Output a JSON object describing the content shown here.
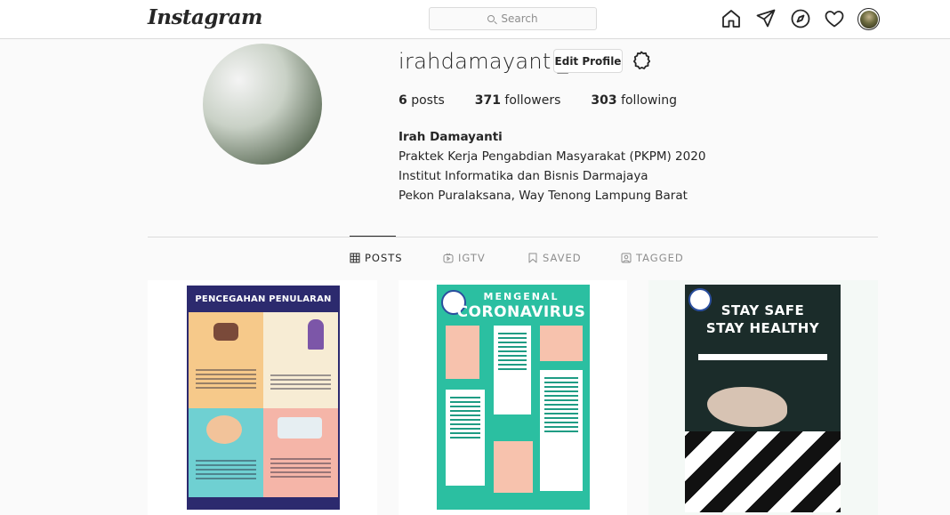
{
  "nav": {
    "logo": "Instagram",
    "search_placeholder": "Search",
    "icons": [
      "home-icon",
      "direct-icon",
      "explore-icon",
      "activity-heart-icon",
      "profile-avatar"
    ]
  },
  "profile": {
    "username": "irahdamayanti_",
    "edit_button": "Edit Profile",
    "stats": {
      "posts_count": "6",
      "posts_label": "posts",
      "followers_count": "371",
      "followers_label": "followers",
      "following_count": "303",
      "following_label": "following"
    },
    "full_name": "Irah Damayanti",
    "bio_lines": [
      "Praktek Kerja Pengabdian Masyarakat (PKPM) 2020",
      "Institut Informatika dan Bisnis Darmajaya",
      "Pekon Puralaksana, Way Tenong Lampung Barat"
    ]
  },
  "tabs": [
    {
      "label": "POSTS",
      "active": true
    },
    {
      "label": "IGTV",
      "active": false
    },
    {
      "label": "SAVED",
      "active": false
    },
    {
      "label": "TAGGED",
      "active": false
    }
  ],
  "posts": [
    {
      "title": "PENCEGAHAN PENULARAN"
    },
    {
      "subtitle": "MENGENAL",
      "title": "CORONAVIRUS"
    },
    {
      "line1": "STAY SAFE",
      "line2": "STAY HEALTHY"
    }
  ],
  "colors": {
    "border": "#dbdbdb",
    "text": "#262626",
    "muted": "#8e8e8e",
    "background": "#fafafa"
  }
}
